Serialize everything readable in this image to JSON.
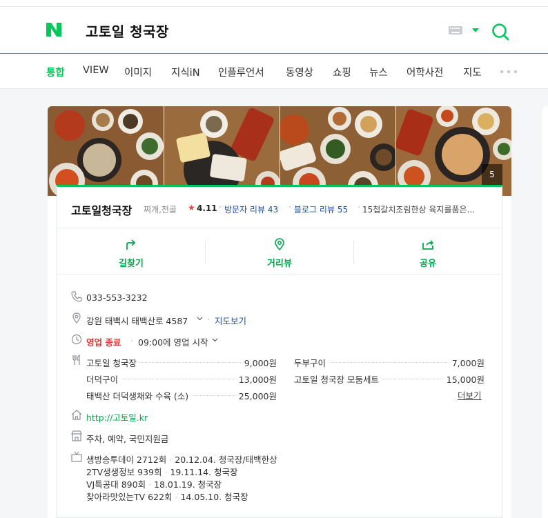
{
  "search": {
    "query": "고토일 청국장"
  },
  "colors": {
    "brand": "#03c75a",
    "link": "#1f4e9c",
    "alert": "#e1383b"
  },
  "tabs": [
    "통합",
    "VIEW",
    "이미지",
    "지식iN",
    "인플루언서",
    "동영상",
    "쇼핑",
    "뉴스",
    "어학사전",
    "지도"
  ],
  "place": {
    "photo_count": "5",
    "name": "고토일청국장",
    "category": "찌개,전골",
    "rating_star": "★",
    "rating": "4.11",
    "visitor_review_label": "방문자 리뷰",
    "visitor_review_count": "43",
    "blog_review_label": "블로그 리뷰",
    "blog_review_count": "55",
    "description": "15첩갈치조림한상 육지를품은..."
  },
  "actions": [
    {
      "label": "길찾기",
      "icon": "directions-icon"
    },
    {
      "label": "거리뷰",
      "icon": "location-pin-icon"
    },
    {
      "label": "공유",
      "icon": "share-icon"
    }
  ],
  "details": {
    "phone": "033-553-3232",
    "address": "강원 태백시 태백산로 4587",
    "map_link": "지도보기",
    "status": "영업 종료",
    "open_time": "09:00에 영업 시작",
    "website": "http://고토일.kr",
    "facilities": "주차, 예약, 국민지원금"
  },
  "menu": {
    "items": [
      {
        "name": "고토일 청국장",
        "price": "9,000원"
      },
      {
        "name": "두부구이",
        "price": "7,000원"
      },
      {
        "name": "더덕구이",
        "price": "13,000원"
      },
      {
        "name": "고토일 청국장 모둠세트",
        "price": "15,000원"
      },
      {
        "name": "태백산 더덕생채와 수육 (소)",
        "price": "25,000원"
      }
    ],
    "more_label": "더보기"
  },
  "tv": [
    {
      "show": "생방송투데이 2712회",
      "detail": "20.12.04. 청국장/태백한상"
    },
    {
      "show": "2TV생생정보 939회",
      "detail": "19.11.14. 청국장"
    },
    {
      "show": "VJ특공대 890회",
      "detail": "18.01.19. 청국장"
    },
    {
      "show": "찾아라맛있는TV 622회",
      "detail": "14.05.10. 청국장"
    }
  ]
}
